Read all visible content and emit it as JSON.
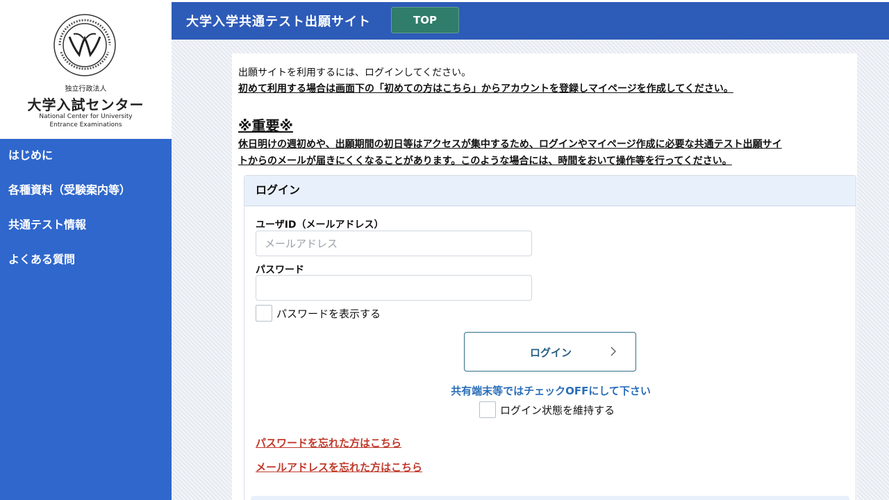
{
  "logo": {
    "sub": "独立行政法人",
    "name": "大学入試センター",
    "en_line1": "National Center for University",
    "en_line2": "Entrance Examinations"
  },
  "sidebar": {
    "items": [
      {
        "label": "はじめに"
      },
      {
        "label": "各種資料（受験案内等）"
      },
      {
        "label": "共通テスト情報"
      },
      {
        "label": "よくある質問"
      }
    ]
  },
  "header": {
    "title": "大学入学共通テスト出願サイト",
    "top_button": "TOP"
  },
  "intro": {
    "line1": "出願サイトを利用するには、ログインしてください。",
    "line2": "初めて利用する場合は画面下の「初めての方はこちら」からアカウントを登録しマイページを作成してください。"
  },
  "important": {
    "title": "※重要※",
    "line1": "休日明けの週初めや、出願期間の初日等はアクセスが集中するため、ログインやマイページ作成に必要な共通テスト出願サイ",
    "line2": "トからのメールが届きにくくなることがあります。このような場合には、時間をおいて操作等を行ってください。"
  },
  "login": {
    "heading": "ログイン",
    "user_id_label": "ユーザID（メールアドレス）",
    "user_id_placeholder": "メールアドレス",
    "user_id_value": "",
    "password_label": "パスワード",
    "password_value": "",
    "show_password_label": "パスワードを表示する",
    "button_label": "ログイン",
    "shared_notice": "共有端末等ではチェックOFFにして下さい",
    "keep_login_label": "ログイン状態を維持する",
    "forgot_password": "パスワードを忘れた方はこちら",
    "forgot_email": "メールアドレスを忘れた方はこちら"
  },
  "colors": {
    "sidebar_bg": "#2f67cc",
    "header_bg": "#2d5bb8",
    "top_button_bg": "#2f7d6a",
    "link_red": "#c0392b",
    "notice_blue": "#2a6eb8"
  }
}
